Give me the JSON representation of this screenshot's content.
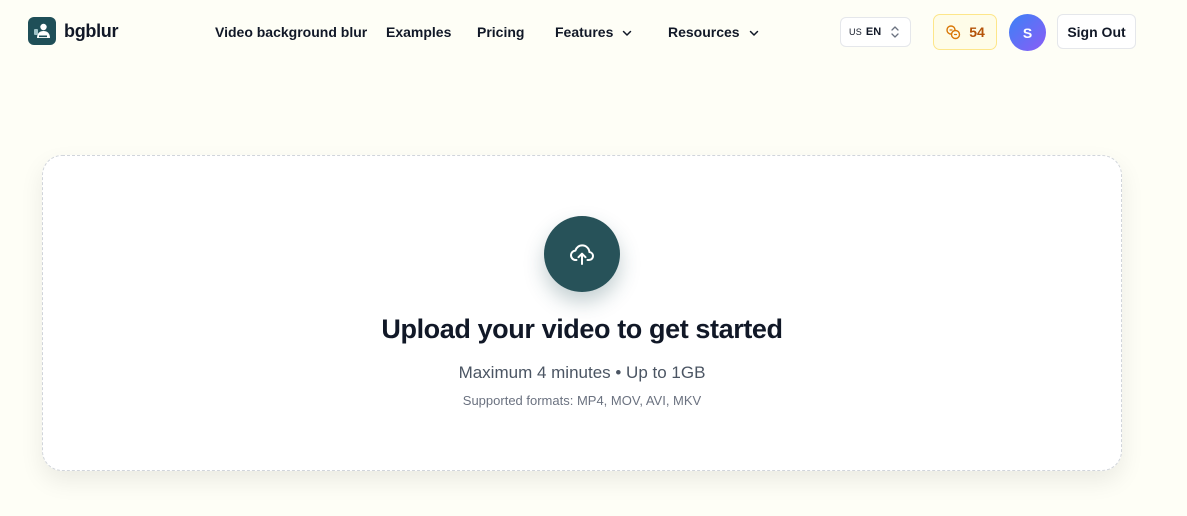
{
  "brand": {
    "name": "bgblur",
    "color": "#1f4f58"
  },
  "nav": {
    "links": [
      {
        "label": "Video background blur"
      },
      {
        "label": "Examples"
      },
      {
        "label": "Pricing"
      },
      {
        "label": "Features"
      },
      {
        "label": "Resources"
      }
    ]
  },
  "language": {
    "flag": "US",
    "code": "EN"
  },
  "credits": {
    "count": "54"
  },
  "user": {
    "initial": "S"
  },
  "auth": {
    "signout_label": "Sign Out"
  },
  "upload": {
    "title": "Upload your video to get started",
    "limits": "Maximum 4 minutes • Up to 1GB",
    "formats": "Supported formats: MP4, MOV, AVI, MKV"
  },
  "colors": {
    "page_bg": "#fefef6",
    "primary": "#275259",
    "credits_text": "#b45309",
    "avatar_from": "#3b82f6",
    "avatar_to": "#8b5cf6"
  }
}
